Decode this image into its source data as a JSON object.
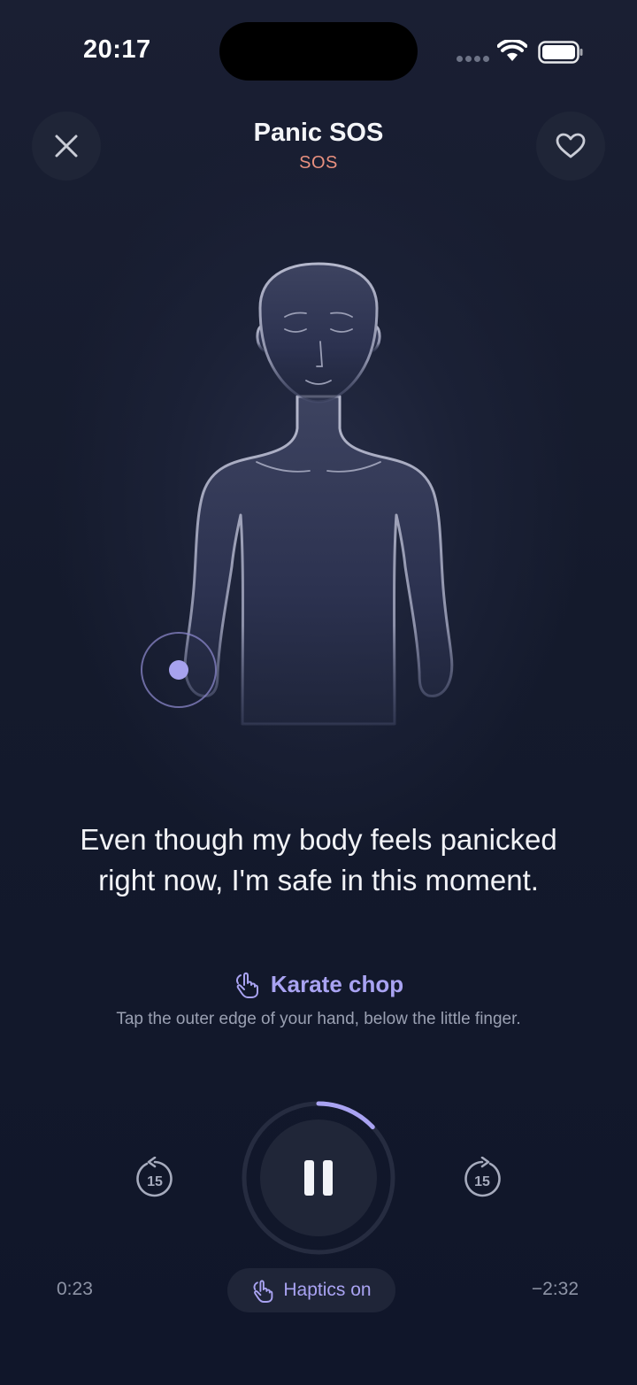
{
  "status_bar": {
    "time": "20:17"
  },
  "header": {
    "title": "Panic SOS",
    "subtitle": "SOS",
    "close_icon": "close-icon",
    "favorite_icon": "heart-icon"
  },
  "affirmation": {
    "line1": "Even though my body feels panicked",
    "line2": "right now, I'm safe in this moment."
  },
  "step": {
    "icon": "tap-hand-icon",
    "title": "Karate chop",
    "description": "Tap the outer edge of your hand, below the little finger."
  },
  "player": {
    "skip_back": "15",
    "skip_forward": "15",
    "progress_fraction": 0.13,
    "elapsed": "0:23",
    "remaining": "−2:32",
    "state_icon": "pause-icon"
  },
  "haptics": {
    "icon": "tap-hand-icon",
    "label": "Haptics on"
  },
  "colors": {
    "accent": "#a9a3f2",
    "subtitle": "#e8907f",
    "background": "#141a2c"
  }
}
